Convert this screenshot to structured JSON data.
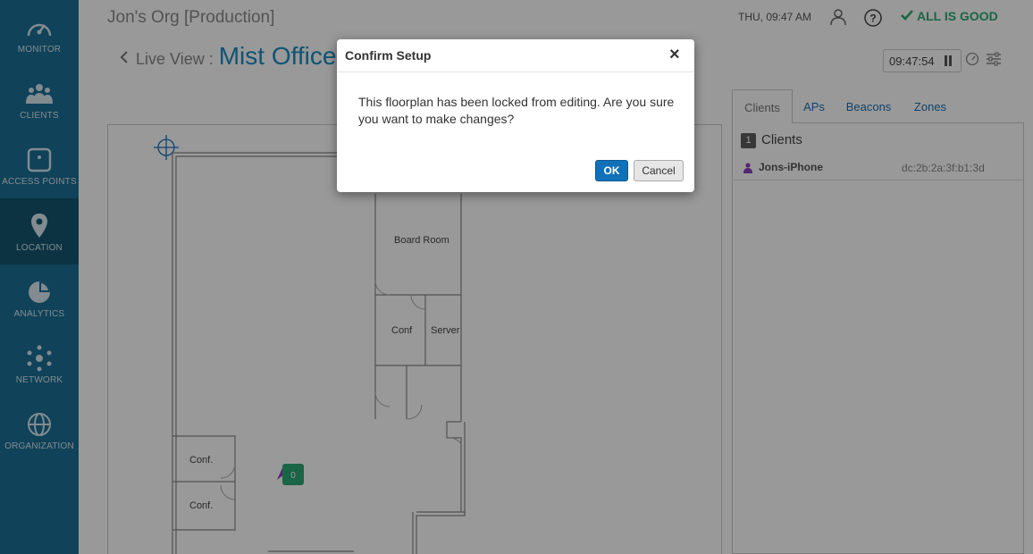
{
  "sidebar": {
    "items": [
      {
        "label": "MONITOR",
        "icon": "gauge-icon"
      },
      {
        "label": "CLIENTS",
        "icon": "users-icon"
      },
      {
        "label": "ACCESS POINTS",
        "icon": "access-point-icon"
      },
      {
        "label": "LOCATION",
        "icon": "map-pin-icon",
        "active": true
      },
      {
        "label": "ANALYTICS",
        "icon": "pie-chart-icon"
      },
      {
        "label": "NETWORK",
        "icon": "network-icon"
      },
      {
        "label": "ORGANIZATION",
        "icon": "globe-icon"
      }
    ]
  },
  "header": {
    "org_title": "Jon's Org [Production]",
    "datetime": "THU, 09:47 AM",
    "status": "ALL IS GOOD"
  },
  "live_view": {
    "label": "Live View :",
    "site_name": "Mist Office",
    "time": "09:47:54"
  },
  "map": {
    "rooms": [
      "Board Room",
      "Conf",
      "Server",
      "Conf.",
      "Conf."
    ],
    "client_marker_count": "0"
  },
  "right_panel": {
    "tabs": [
      "Clients",
      "APs",
      "Beacons",
      "Zones"
    ],
    "clients_count": "1",
    "clients_heading": "Clients",
    "clients": [
      {
        "name": "Jons-iPhone",
        "mac": "dc:2b:2a:3f:b1:3d"
      }
    ]
  },
  "modal": {
    "title": "Confirm Setup",
    "close": "×",
    "message": "This floorplan has been locked from editing. Are you sure you want to make changes?",
    "ok_label": "OK",
    "cancel_label": "Cancel"
  },
  "colors": {
    "sidebar": "#1b6e94",
    "accent": "#1b8cc2",
    "status_good": "#2aa876",
    "ok_button": "#1071b8"
  }
}
